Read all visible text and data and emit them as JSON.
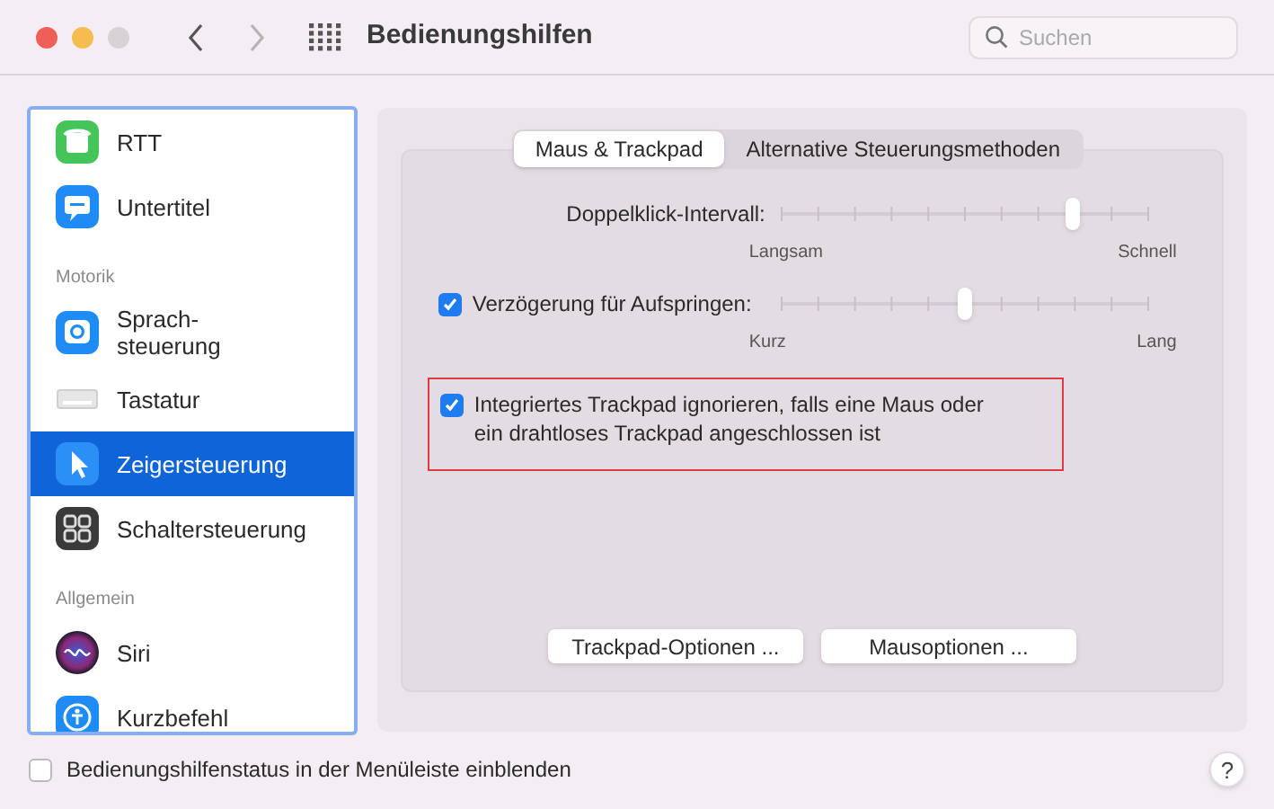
{
  "window": {
    "title": "Bedienungshilfen"
  },
  "search": {
    "placeholder": "Suchen"
  },
  "sidebar": {
    "items": [
      {
        "kind": "item",
        "label": "RTT",
        "selected": false
      },
      {
        "kind": "item",
        "label": "Untertitel",
        "selected": false
      },
      {
        "kind": "header",
        "label": "Motorik"
      },
      {
        "kind": "item",
        "label": "Sprach-\nsteuerung",
        "selected": false
      },
      {
        "kind": "item",
        "label": "Tastatur",
        "selected": false
      },
      {
        "kind": "item",
        "label": "Zeigersteuerung",
        "selected": true
      },
      {
        "kind": "item",
        "label": "Schaltersteuerung",
        "selected": false
      },
      {
        "kind": "header",
        "label": "Allgemein"
      },
      {
        "kind": "item",
        "label": "Siri",
        "selected": false
      },
      {
        "kind": "item",
        "label": "Kurzbefehl",
        "selected": false
      }
    ]
  },
  "tabs": [
    {
      "label": "Maus & Trackpad",
      "selected": true
    },
    {
      "label": "Alternative Steuerungsmethoden",
      "selected": false
    }
  ],
  "settings": [
    {
      "kind": "slider",
      "label": "Doppelklick-Intervall:",
      "level": 0.79,
      "min_label": "Langsam",
      "max_label": "Schnell"
    },
    {
      "kind": "slider",
      "label": "Verzögerung für Aufspringen:",
      "checked": true,
      "level": 0.5,
      "min_label": "Kurz",
      "max_label": "Lang"
    },
    {
      "kind": "checkbox",
      "label": "Integriertes Trackpad ignorieren, falls eine Maus oder\nein drahtloses Trackpad angeschlossen ist",
      "checked": true,
      "highlighted": true
    }
  ],
  "buttons": [
    "Trackpad-Optionen ...",
    "Mausoptionen ..."
  ],
  "footer": {
    "label": "Bedienungshilfenstatus in der Menüleiste einblenden",
    "checked": false,
    "help": "?"
  }
}
